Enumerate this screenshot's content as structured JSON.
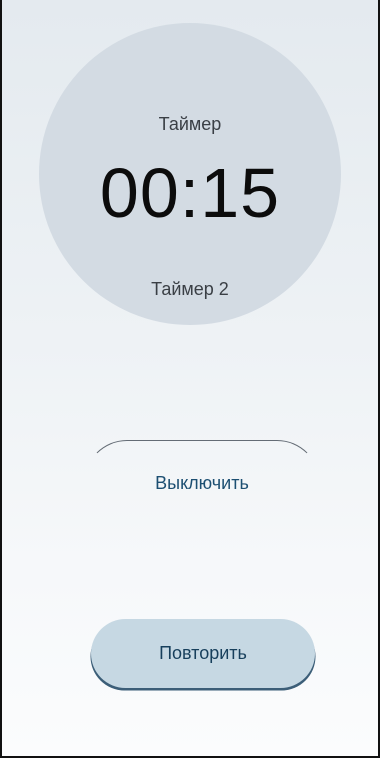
{
  "timer": {
    "title": "Таймер",
    "time": "00:15",
    "subtitle": "Таймер 2"
  },
  "actions": {
    "stop_label": "Выключить",
    "repeat_label": "Повторить"
  },
  "colors": {
    "circle": "#d3dbe3",
    "accent_text": "#1c4f72",
    "repeat_button_bg": "#c6d8e3"
  }
}
